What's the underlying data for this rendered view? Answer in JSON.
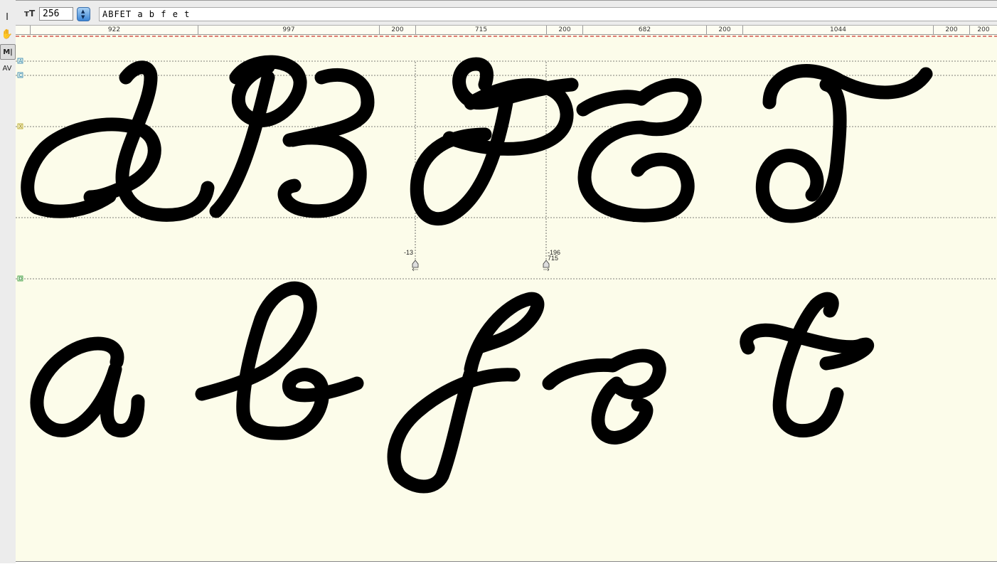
{
  "left_toolbar": {
    "tools": [
      {
        "name": "text-cursor-tool",
        "glyph": "I"
      },
      {
        "name": "hand-tool",
        "glyph": "✋"
      },
      {
        "name": "metrics-tool",
        "glyph": "M|"
      },
      {
        "name": "kerning-tool",
        "glyph": "AV"
      }
    ]
  },
  "top_bar": {
    "size_icon": "ᴛT",
    "point_size": "256",
    "sample_text": "ABFET a b f e t"
  },
  "ruler": {
    "segments": [
      "922",
      "997",
      "200",
      "715",
      "200",
      "682",
      "200",
      "1044",
      "200",
      "200"
    ]
  },
  "guides": {
    "labels": [
      "A",
      "C",
      "X",
      "D"
    ],
    "colors": {
      "A": "#2a7fb0",
      "C": "#2a7fb0",
      "X": "#b0a020",
      "D": "#3a9a3a"
    }
  },
  "metrics": {
    "left_sidebearing": "-13",
    "right_sidebearing": "-196",
    "advance_width": "715"
  },
  "colors": {
    "canvas_bg": "#fcfcea",
    "glyph_fill": "#000000",
    "baseline_red": "#c00000",
    "stepper_blue": "#3c86d6"
  }
}
